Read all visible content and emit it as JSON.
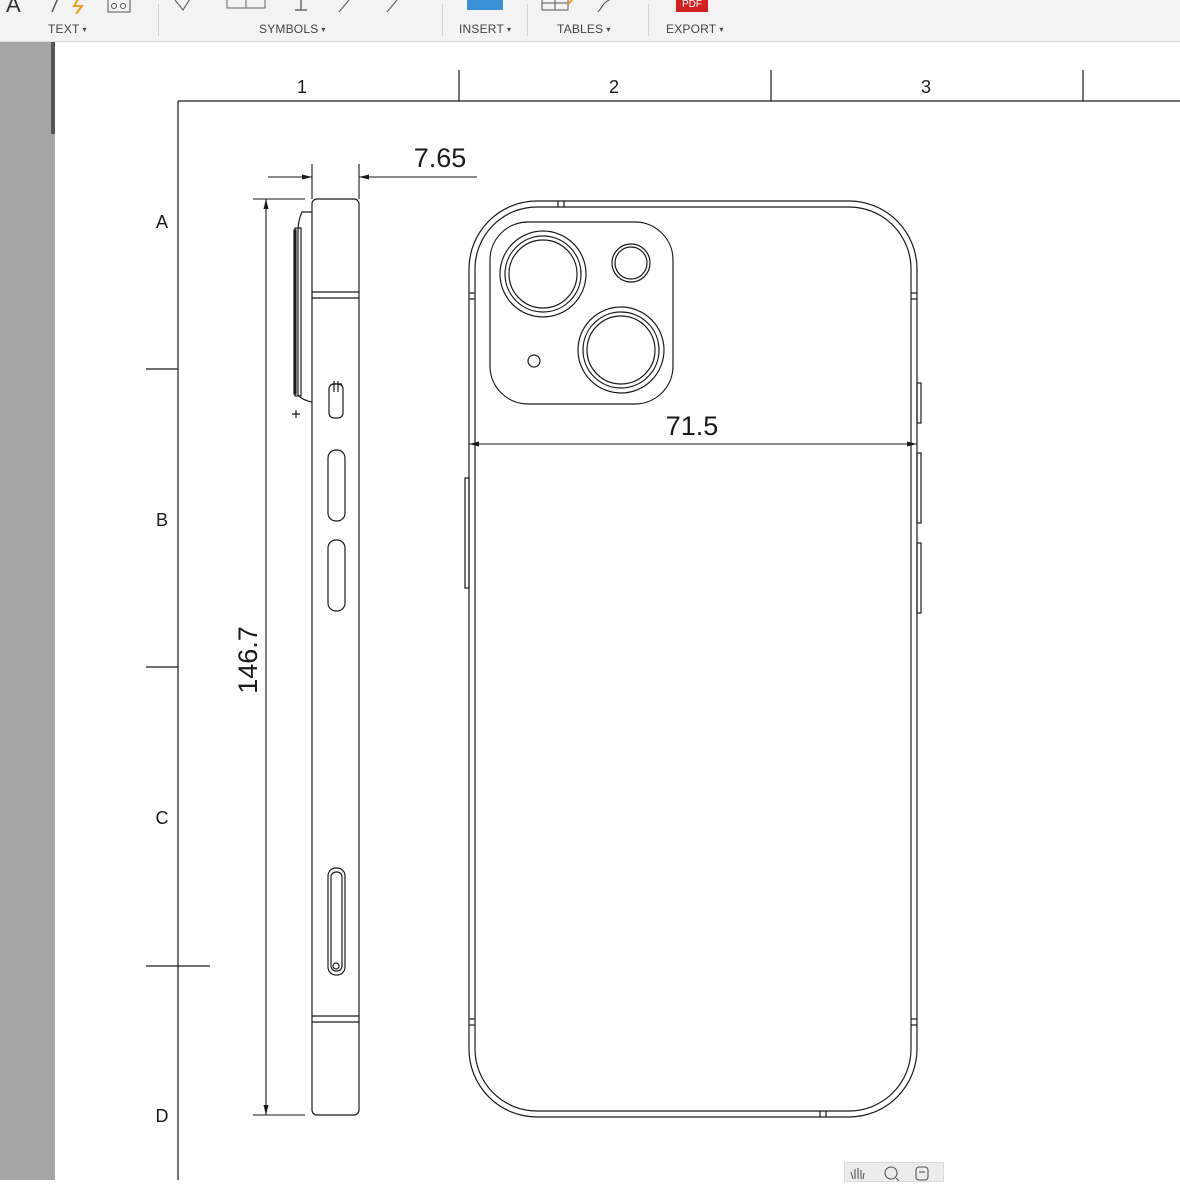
{
  "toolbar": {
    "groups": [
      {
        "label": "TEXT",
        "icon": "text-icon"
      },
      {
        "label": "SYMBOLS",
        "icon": "symbols-icon"
      },
      {
        "label": "INSERT",
        "icon": "insert-icon"
      },
      {
        "label": "TABLES",
        "icon": "tables-icon"
      },
      {
        "label": "EXPORT",
        "icon": "pdf-export-icon",
        "icon_text": "PDF"
      }
    ],
    "caret": "▾"
  },
  "sheet": {
    "columns": [
      "1",
      "2",
      "3"
    ],
    "rows": [
      "A",
      "B",
      "C",
      "D"
    ]
  },
  "dimensions": {
    "thickness": "7.65",
    "height": "146.7",
    "width": "71.5"
  },
  "nav_tools": [
    "pan-icon",
    "zoom-icon",
    "orbit-icon"
  ],
  "colors": {
    "toolbar_bg": "#f3f3f3",
    "gutter": "#a5a5a5",
    "line": "#1a1a1a",
    "insert_accent": "#3b8fd6",
    "pdf_red": "#d32020",
    "lightning": "#f0a020"
  }
}
